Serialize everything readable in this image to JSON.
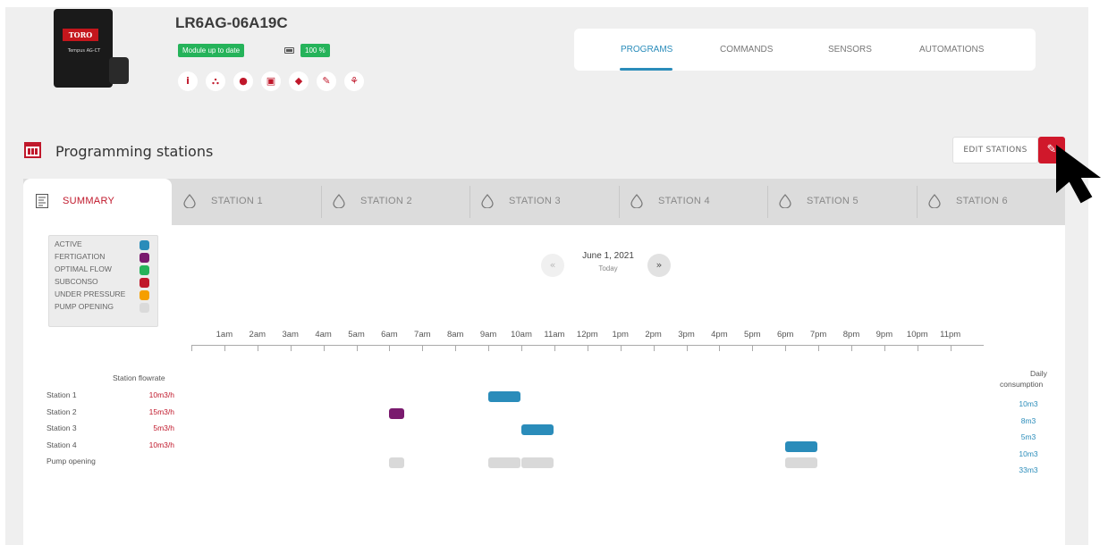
{
  "device": {
    "brand": "TORO",
    "model": "Tempus AG-CT",
    "id": "LR6AG-06A19C",
    "status_badge": "Module up to date",
    "battery": "100 %",
    "actions": [
      {
        "icon": "info-icon",
        "glyph": "i"
      },
      {
        "icon": "network-icon",
        "glyph": "⛬"
      },
      {
        "icon": "globe-icon",
        "glyph": "●"
      },
      {
        "icon": "save-icon",
        "glyph": "▣"
      },
      {
        "icon": "tag-icon",
        "glyph": "◆"
      },
      {
        "icon": "pencil-icon",
        "glyph": "✎"
      },
      {
        "icon": "plant-icon",
        "glyph": "⚘"
      }
    ]
  },
  "nav": {
    "tabs": [
      "PROGRAMS",
      "COMMANDS",
      "SENSORS",
      "AUTOMATIONS"
    ],
    "active": "PROGRAMS"
  },
  "section": {
    "title": "Programming stations",
    "edit_button": "EDIT STATIONS"
  },
  "tabs": {
    "summary": "SUMMARY",
    "stations": [
      "STATION 1",
      "STATION 2",
      "STATION 3",
      "STATION 4",
      "STATION 5",
      "STATION 6"
    ]
  },
  "legend": [
    {
      "label": "ACTIVE",
      "color": "#2a8cba"
    },
    {
      "label": "FERTIGATION",
      "color": "#7a1a6e"
    },
    {
      "label": "OPTIMAL FLOW",
      "color": "#25b35a"
    },
    {
      "label": "SUBCONSO",
      "color": "#c0182b"
    },
    {
      "label": "UNDER PRESSURE",
      "color": "#f59f00"
    },
    {
      "label": "PUMP OPENING",
      "color": "#dadada"
    }
  ],
  "date": {
    "prev": "«",
    "next": "»",
    "value": "June 1, 2021",
    "sub": "Today"
  },
  "timeline": {
    "hours": [
      "1am",
      "2am",
      "3am",
      "4am",
      "5am",
      "6am",
      "7am",
      "8am",
      "9am",
      "10am",
      "11am",
      "12pm",
      "1pm",
      "2pm",
      "3pm",
      "4pm",
      "5pm",
      "6pm",
      "7pm",
      "8pm",
      "9pm",
      "10pm",
      "11pm"
    ],
    "flowrate_header": "Station flowrate",
    "consumption_header_1": "Daily",
    "consumption_header_2": "consumption",
    "rows": [
      {
        "name": "Station 1",
        "flow": "10m3/h",
        "consumption": "10m3"
      },
      {
        "name": "Station 2",
        "flow": "15m3/h",
        "consumption": "8m3"
      },
      {
        "name": "Station 3",
        "flow": "5m3/h",
        "consumption": "5m3"
      },
      {
        "name": "Station 4",
        "flow": "10m3/h",
        "consumption": "10m3"
      },
      {
        "name": "Pump opening",
        "flow": "",
        "consumption": "33m3"
      }
    ],
    "events": [
      {
        "row": 0,
        "start": 9.0,
        "end": 10.0,
        "type": "active"
      },
      {
        "row": 1,
        "start": 6.0,
        "end": 6.5,
        "type": "fertigation"
      },
      {
        "row": 2,
        "start": 10.0,
        "end": 11.0,
        "type": "active"
      },
      {
        "row": 3,
        "start": 18.0,
        "end": 19.0,
        "type": "active"
      },
      {
        "row": 4,
        "start": 6.0,
        "end": 6.5,
        "type": "pump"
      },
      {
        "row": 4,
        "start": 9.0,
        "end": 10.0,
        "type": "pump"
      },
      {
        "row": 4,
        "start": 10.0,
        "end": 11.0,
        "type": "pump"
      },
      {
        "row": 4,
        "start": 18.0,
        "end": 19.0,
        "type": "pump"
      }
    ]
  }
}
